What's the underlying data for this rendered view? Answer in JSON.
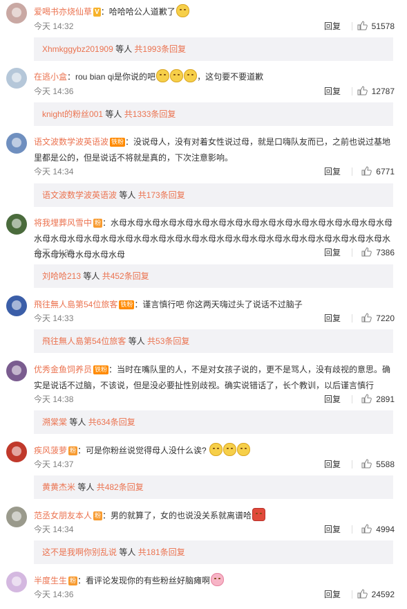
{
  "comments": [
    {
      "user": "爱喝书亦烧仙草",
      "badges": [
        {
          "type": "v",
          "text": "V"
        }
      ],
      "text": "：哈哈哈公人道歉了",
      "emojis": [
        "grin-emoji"
      ],
      "time": "今天 14:32",
      "reply": "回复",
      "likes": "51578",
      "sub": {
        "name": "Xhmkggybz201909",
        "mid": " 等人 ",
        "total": "共1993条回复"
      }
    },
    {
      "user": "在逃小盒",
      "badges": [],
      "text": "：rou bian qi是你说的吧",
      "emojis": [
        "laugh-emoji",
        "laugh-emoji",
        "laugh-emoji"
      ],
      "text_after": "，这句要不要道歉",
      "time": "今天 14:36",
      "reply": "回复",
      "likes": "12787",
      "sub": {
        "name": "knight的粉丝001",
        "mid": " 等人 ",
        "total": "共1333条回复"
      }
    },
    {
      "user": "语文波数学波英语波",
      "badges": [
        {
          "type": "fan",
          "text": "铁粉"
        }
      ],
      "text": "：没说母人，没有对着女性说过母，就是口嗨队友而已，之前也说过基地里都是公的，但是说话不将就是真的，下次注意影响。",
      "time": "今天 14:34",
      "reply": "回复",
      "likes": "6771",
      "sub": {
        "name": "语文波数学波英语波",
        "mid": " 等人 ",
        "total": "共173条回复"
      }
    },
    {
      "user": "将我埋葬风雪中",
      "badges": [
        {
          "type": "lvl",
          "text": "粉"
        }
      ],
      "text": "：水母水母水母水母水母水母水母水母水母水母水母水母水母水母水母水母水母水母水母水母水母水母水母水母水母水母水母水母水母水母水母水母水母水母水母水母水母水母水母水母水母水母水母水母",
      "time": "今天 14:35",
      "reply": "回复",
      "likes": "7386",
      "sub": {
        "name": "刘哈哈213",
        "mid": " 等人 ",
        "total": "共452条回复"
      }
    },
    {
      "user": "飛往無人島第54位旅客",
      "badges": [
        {
          "type": "fan",
          "text": "铁粉"
        }
      ],
      "text": "：谨言慎行吧 你这两天嗨过头了说话不过脑子",
      "time": "今天 14:33",
      "reply": "回复",
      "likes": "7220",
      "sub": {
        "name": "飛往無人島第54位旅客",
        "mid": " 等人 ",
        "total": "共53条回复"
      }
    },
    {
      "user": "优秀金鱼饲养员",
      "badges": [
        {
          "type": "fan",
          "text": "铁粉"
        }
      ],
      "text": "：当时在嘴队里的人，不是对女孩子说的，更不是骂人，没有歧视的意思。确实是说话不过脑，不该说，但是没必要扯性别歧视。确实说错话了，长个教训，以后谨言慎行",
      "time": "今天 14:38",
      "reply": "回复",
      "likes": "2891",
      "sub": {
        "name": "溯棠棠",
        "mid": " 等人 ",
        "total": "共634条回复"
      }
    },
    {
      "user": "疾风菠萝",
      "badges": [
        {
          "type": "lvl",
          "text": "粉"
        }
      ],
      "text": "：可是你粉丝说觉得母人没什么诶?",
      "emojis": [
        "puzzled-emoji",
        "puzzled-emoji",
        "puzzled-emoji"
      ],
      "time": "今天 14:37",
      "reply": "回复",
      "likes": "5588",
      "sub": {
        "name": "黄黄杰米",
        "mid": " 等人 ",
        "total": "共482条回复"
      }
    },
    {
      "user": "范丞女朋友本人",
      "badges": [
        {
          "type": "lvl",
          "text": "粉"
        }
      ],
      "text": "：男的就算了，女的也说没关系就离谱哈",
      "emojis": [
        "rice-emoji"
      ],
      "time": "今天 14:34",
      "reply": "回复",
      "likes": "4994",
      "sub": {
        "name": "这不是我啊你别乱说",
        "mid": " 等人 ",
        "total": "共181条回复"
      }
    },
    {
      "user": "半度生生",
      "badges": [
        {
          "type": "lvl",
          "text": "粉"
        }
      ],
      "text": "：看评论发现你的有些粉丝好脑瘫啊",
      "emojis": [
        "pig-emoji"
      ],
      "time": "今天 14:36",
      "reply": "回复",
      "likes": "24592"
    }
  ],
  "avatar_colors": [
    "#c9a8a3",
    "#b5c7d9",
    "#6f8fbf",
    "#4a6b3c",
    "#3b5ea8",
    "#7a5c8f",
    "#c0392b",
    "#9a9a8c",
    "#d4b8e0"
  ]
}
